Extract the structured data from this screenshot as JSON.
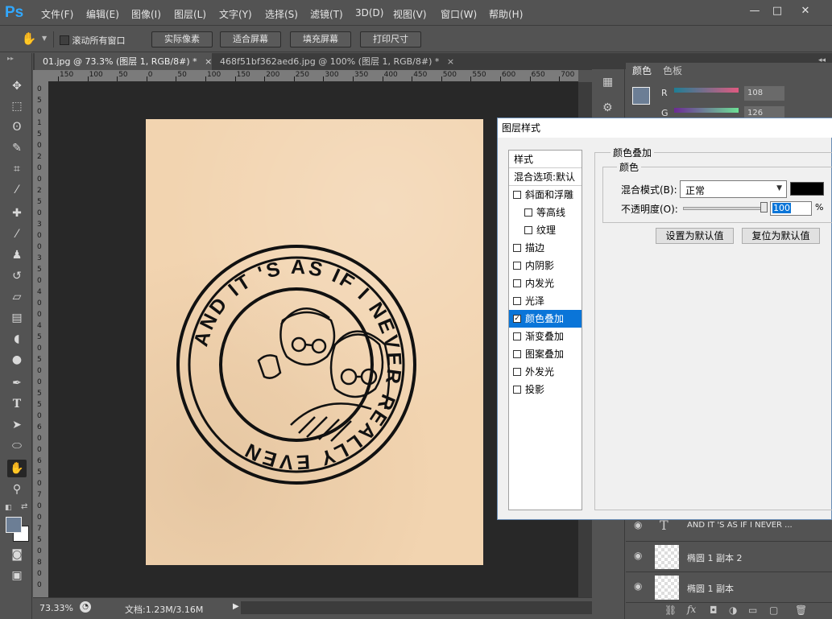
{
  "app": {
    "logo": "Ps"
  },
  "menu": [
    "文件(F)",
    "编辑(E)",
    "图像(I)",
    "图层(L)",
    "文字(Y)",
    "选择(S)",
    "滤镜(T)",
    "3D(D)",
    "视图(V)",
    "窗口(W)",
    "帮助(H)"
  ],
  "window_controls": {
    "minimize": "—",
    "maximize": "□",
    "close": "✕"
  },
  "options_bar": {
    "scroll_all_label": "滚动所有窗口",
    "buttons": [
      "实际像素",
      "适合屏幕",
      "填充屏幕",
      "打印尺寸"
    ]
  },
  "tabs": [
    {
      "label": "01.jpg @ 73.3% (图层 1, RGB/8#) *",
      "close": "×"
    },
    {
      "label": "468f51bf362aed6.jpg @ 100% (图层 1, RGB/8#) *",
      "close": "×"
    }
  ],
  "ruler": {
    "h_labels": [
      "150",
      "100",
      "50",
      "0",
      "50",
      "100",
      "150",
      "200",
      "250",
      "300",
      "350",
      "400",
      "450",
      "500",
      "550",
      "600",
      "650",
      "700"
    ],
    "v_labels": [
      "0",
      "5",
      "0",
      "1",
      "5",
      "0",
      "2",
      "0",
      "0",
      "2",
      "5",
      "0",
      "3",
      "0",
      "0",
      "3",
      "5",
      "0",
      "4",
      "0",
      "0",
      "4",
      "5",
      "0",
      "5",
      "0",
      "0",
      "5",
      "5",
      "0",
      "6",
      "0",
      "0",
      "6",
      "5",
      "0",
      "7",
      "0",
      "0",
      "7",
      "5",
      "0",
      "8",
      "0",
      "0"
    ]
  },
  "artwork": {
    "ring_text": "AND IT 'S AS IF I NEVER REALLY EVEN",
    "ink_color": "#111111"
  },
  "status": {
    "zoom": "73.33%",
    "doc_label": "文档:1.23M/3.16M"
  },
  "right_panel": {
    "tabs": [
      "颜色",
      "色板"
    ],
    "channels": [
      {
        "name": "R",
        "value": "108"
      },
      {
        "name": "G",
        "value": "126"
      }
    ],
    "layers": [
      {
        "name": "AND IT 'S AS IF I NEVER ...",
        "type": "T"
      },
      {
        "name": "椭圆 1 副本 2",
        "type": "shape"
      },
      {
        "name": "椭圆 1 副本",
        "type": "shape"
      }
    ]
  },
  "dialog": {
    "title": "图层样式",
    "list_header": "样式",
    "blend_options": "混合选项:默认",
    "effects": [
      {
        "label": "斜面和浮雕",
        "checked": false,
        "indent": 0
      },
      {
        "label": "等高线",
        "checked": false,
        "indent": 1
      },
      {
        "label": "纹理",
        "checked": false,
        "indent": 1
      },
      {
        "label": "描边",
        "checked": false,
        "indent": 0
      },
      {
        "label": "内阴影",
        "checked": false,
        "indent": 0
      },
      {
        "label": "内发光",
        "checked": false,
        "indent": 0
      },
      {
        "label": "光泽",
        "checked": false,
        "indent": 0
      },
      {
        "label": "颜色叠加",
        "checked": true,
        "indent": 0,
        "selected": true
      },
      {
        "label": "渐变叠加",
        "checked": false,
        "indent": 0
      },
      {
        "label": "图案叠加",
        "checked": false,
        "indent": 0
      },
      {
        "label": "外发光",
        "checked": false,
        "indent": 0
      },
      {
        "label": "投影",
        "checked": false,
        "indent": 0
      }
    ],
    "section_title": "颜色叠加",
    "subsection_title": "颜色",
    "blend_mode_label": "混合模式(B):",
    "blend_mode_value": "正常",
    "overlay_color": "#000000",
    "opacity_label": "不透明度(O):",
    "opacity_value": "100",
    "opacity_unit": "%",
    "set_default": "设置为默认值",
    "reset_default": "复位为默认值"
  },
  "colors": {
    "panel": "#535353",
    "canvas_bg": "#282828",
    "paper": "#f2d4b0",
    "selection": "#0a75d8",
    "ps_blue": "#31a8ff"
  }
}
